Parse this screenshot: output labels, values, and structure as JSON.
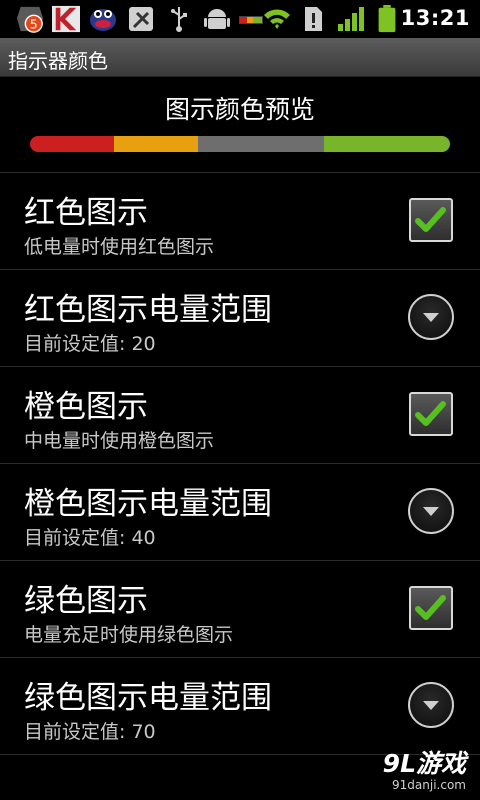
{
  "status_bar": {
    "time": "13:21",
    "notification_badge": "5",
    "icons": [
      "notification-badge-icon",
      "kaspersky-icon",
      "mascot-icon",
      "satellite-icon",
      "usb-icon",
      "android-debug-icon",
      "battery-bar-icon",
      "wifi-icon",
      "sd-warning-icon",
      "signal-icon",
      "battery-icon"
    ],
    "colors": {
      "badge": "#e24a1c",
      "wifi": "#7ec224",
      "signal": "#7ec224",
      "battery": "#7ec224"
    }
  },
  "title_bar": {
    "title": "指示器颜色"
  },
  "preview": {
    "title": "图示颜色预览",
    "segments": [
      {
        "color": "#cc2020",
        "fraction": 0.2
      },
      {
        "color": "#e8a010",
        "fraction": 0.2
      },
      {
        "color": "#6e6e6e",
        "fraction": 0.3
      },
      {
        "color": "#79b52a",
        "fraction": 0.3
      }
    ]
  },
  "settings": [
    {
      "title": "红色图示",
      "summary": "低电量时使用红色图示",
      "control": "checkbox",
      "checked": true
    },
    {
      "title": "红色图示电量范围",
      "summary": "目前设定值: 20",
      "control": "dropdown"
    },
    {
      "title": "橙色图示",
      "summary": "中电量时使用橙色图示",
      "control": "checkbox",
      "checked": true
    },
    {
      "title": "橙色图示电量范围",
      "summary": "目前设定值: 40",
      "control": "dropdown"
    },
    {
      "title": "绿色图示",
      "summary": "电量充足时使用绿色图示",
      "control": "checkbox",
      "checked": true
    },
    {
      "title": "绿色图示电量范围",
      "summary": "目前设定值: 70",
      "control": "dropdown"
    }
  ],
  "watermark": {
    "main": "9L游戏",
    "sub": "91danji.com"
  },
  "accent_check_color": "#56c020"
}
